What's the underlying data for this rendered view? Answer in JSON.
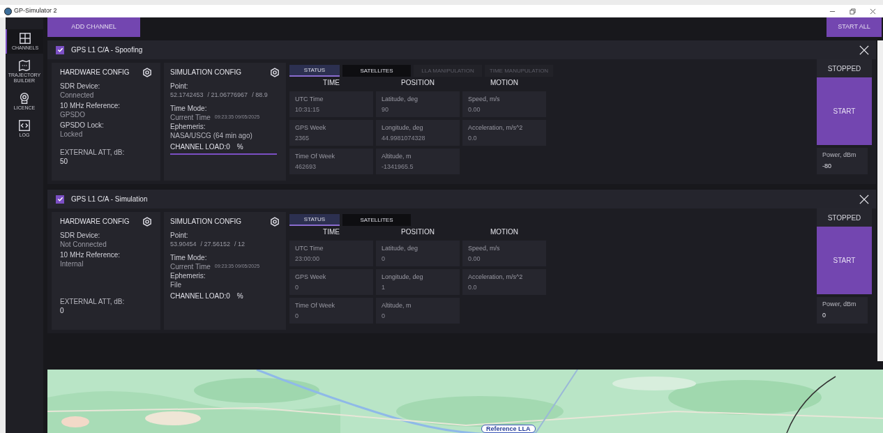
{
  "window": {
    "title": "GP-Simulator 2"
  },
  "sidebar": {
    "items": [
      {
        "label": "CHANNELS",
        "selected": true
      },
      {
        "label": "TRAJECTORY BUILDER",
        "selected": false
      },
      {
        "label": "LICENCE",
        "selected": false
      },
      {
        "label": "LOG",
        "selected": false
      }
    ]
  },
  "toolbar": {
    "add_button": "ADD CHANNEL",
    "start_all_button": "START ALL"
  },
  "channels": [
    {
      "title": "GPS L1 C/A - Spoofing",
      "checked": true,
      "hardware": {
        "title": "HARDWARE CONFIG",
        "fields": [
          {
            "label": "SDR Device:",
            "value": "Connected"
          },
          {
            "label": "10 MHz Reference:",
            "value": "GPSDO"
          },
          {
            "label": "GPSDO Lock:",
            "value": "Locked"
          }
        ],
        "att_label": "EXTERNAL ATT, dB:",
        "att_value": "50"
      },
      "simulation": {
        "title": "SIMULATION CONFIG",
        "point_label": "Point:",
        "point": [
          "52.1742453",
          "/ 21.06776967",
          "/ 88.9"
        ],
        "time_mode_label": "Time Mode:",
        "time_mode": "Current Time",
        "timestamp": "09:23:35 09/05/2025",
        "ephemeris_label": "Ephemeris:",
        "ephemeris": "NASA/USCG (64 min ago)",
        "load_label": "CHANNEL LOAD:0",
        "load_unit": "%",
        "load_bar": true
      },
      "tabs": [
        {
          "label": "STATUS",
          "selected": true,
          "disabled": false
        },
        {
          "label": "SATELLITES",
          "selected": false,
          "disabled": false
        },
        {
          "label": "LLA MANIPULATION",
          "selected": false,
          "disabled": true
        },
        {
          "label": "TIME MANUPULATION",
          "selected": false,
          "disabled": true
        }
      ],
      "columns": [
        {
          "heading": "TIME",
          "cells": [
            {
              "label": "UTC Time",
              "value": "10:31:15"
            },
            {
              "label": "GPS Week",
              "value": "2365"
            },
            {
              "label": "Time Of Week",
              "value": "462693"
            }
          ]
        },
        {
          "heading": "POSITION",
          "cells": [
            {
              "label": "Latitude, deg",
              "value": "90"
            },
            {
              "label": "Longitude, deg",
              "value": "44.9981074328"
            },
            {
              "label": "Altitude, m",
              "value": "-1341965.5"
            }
          ]
        },
        {
          "heading": "MOTION",
          "cells": [
            {
              "label": "Speed, m/s",
              "value": "0.00"
            },
            {
              "label": "Acceleration, m/s^2",
              "value": "0.0"
            }
          ]
        }
      ],
      "state": "STOPPED",
      "start_button": "START",
      "power_label": "Power, dBm",
      "power_value": "-80"
    },
    {
      "title": "GPS L1 C/A - Simulation",
      "checked": true,
      "hardware": {
        "title": "HARDWARE CONFIG",
        "fields": [
          {
            "label": "SDR Device:",
            "value": "Not Connected"
          },
          {
            "label": "10 MHz Reference:",
            "value": "Internal"
          }
        ],
        "att_label": "EXTERNAL ATT, dB:",
        "att_value": "0"
      },
      "simulation": {
        "title": "SIMULATION CONFIG",
        "point_label": "Point:",
        "point": [
          "53.90454",
          "/ 27.56152",
          "/ 12"
        ],
        "time_mode_label": "Time Mode:",
        "time_mode": "Current Time",
        "timestamp": "09:23:35 09/05/2025",
        "ephemeris_label": "Ephemeris:",
        "ephemeris": "File",
        "load_label": "CHANNEL LOAD:0",
        "load_unit": "%",
        "load_bar": false
      },
      "tabs": [
        {
          "label": "STATUS",
          "selected": true,
          "disabled": false
        },
        {
          "label": "SATELLITES",
          "selected": false,
          "disabled": false
        }
      ],
      "columns": [
        {
          "heading": "TIME",
          "cells": [
            {
              "label": "UTC Time",
              "value": "23:00:00"
            },
            {
              "label": "GPS Week",
              "value": "0"
            },
            {
              "label": "Time Of Week",
              "value": "0"
            }
          ]
        },
        {
          "heading": "POSITION",
          "cells": [
            {
              "label": "Latitude, deg",
              "value": "0"
            },
            {
              "label": "Longitude, deg",
              "value": "1"
            },
            {
              "label": "Altitude, m",
              "value": "0"
            }
          ]
        },
        {
          "heading": "MOTION",
          "cells": [
            {
              "label": "Speed, m/s",
              "value": "0.00"
            },
            {
              "label": "Acceleration, m/s^2",
              "value": "0.0"
            }
          ]
        }
      ],
      "state": "STOPPED",
      "start_button": "START",
      "power_label": "Power, dBm",
      "power_value": "0"
    }
  ],
  "map": {
    "kind": "picture",
    "marker_label": "Reference LLA"
  }
}
